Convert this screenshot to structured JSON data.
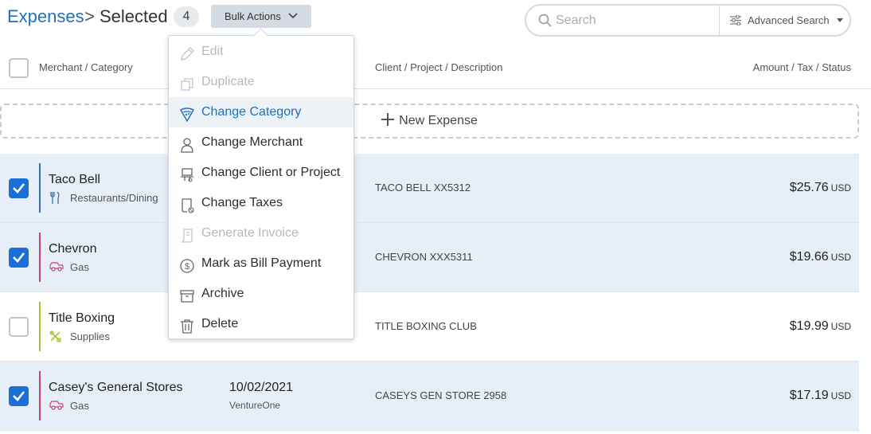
{
  "header": {
    "breadcrumb_root": "Expenses",
    "breadcrumb_separator": ">",
    "breadcrumb_current": "Selected",
    "selected_count": "4",
    "bulk_actions_label": "Bulk Actions",
    "search_placeholder": "Search",
    "advanced_search_label": "Advanced Search"
  },
  "columns": {
    "merchant_category": "Merchant / Category",
    "client_project_description": "Client / Project / Description",
    "amount_tax_status": "Amount / Tax / Status"
  },
  "new_expense_label": "New Expense",
  "bulk_menu": [
    {
      "label": "Edit",
      "icon": "pencil-icon",
      "state": "disabled"
    },
    {
      "label": "Duplicate",
      "icon": "duplicate-icon",
      "state": "disabled"
    },
    {
      "label": "Change Category",
      "icon": "category-icon",
      "state": "active"
    },
    {
      "label": "Change Merchant",
      "icon": "person-icon",
      "state": "enabled"
    },
    {
      "label": "Change Client or Project",
      "icon": "client-project-icon",
      "state": "enabled"
    },
    {
      "label": "Change Taxes",
      "icon": "taxes-icon",
      "state": "enabled"
    },
    {
      "label": "Generate Invoice",
      "icon": "invoice-icon",
      "state": "disabled"
    },
    {
      "label": "Mark as Bill Payment",
      "icon": "dollar-circle-icon",
      "state": "enabled"
    },
    {
      "label": "Archive",
      "icon": "archive-icon",
      "state": "enabled"
    },
    {
      "label": "Delete",
      "icon": "trash-icon",
      "state": "enabled"
    }
  ],
  "expenses": [
    {
      "merchant": "Taco Bell",
      "category": "Restaurants/Dining",
      "category_icon": "fork-knife-icon",
      "category_color": "#2f6fba",
      "date": "",
      "card": "",
      "description": "TACO BELL XX5312",
      "amount": "$25.76",
      "currency": "USD",
      "checked": true
    },
    {
      "merchant": "Chevron",
      "category": "Gas",
      "category_icon": "car-icon",
      "category_color": "#c2447a",
      "date": "",
      "card": "",
      "description": "CHEVRON XXX5311",
      "amount": "$19.66",
      "currency": "USD",
      "checked": true
    },
    {
      "merchant": "Title Boxing",
      "category": "Supplies",
      "category_icon": "tools-icon",
      "category_color": "#a8c23a",
      "date": "",
      "card": "",
      "description": "TITLE BOXING CLUB",
      "amount": "$19.99",
      "currency": "USD",
      "checked": false
    },
    {
      "merchant": "Casey's General Stores",
      "category": "Gas",
      "category_icon": "car-icon",
      "category_color": "#c2447a",
      "date": "10/02/2021",
      "card": "VentureOne",
      "description": "CASEYS GEN STORE 2958",
      "amount": "$17.19",
      "currency": "USD",
      "checked": true
    }
  ],
  "colors": {
    "accent": "#1f6fbf",
    "checkbox_checked": "#1a6fd6",
    "selected_row": "#e6eff8"
  }
}
